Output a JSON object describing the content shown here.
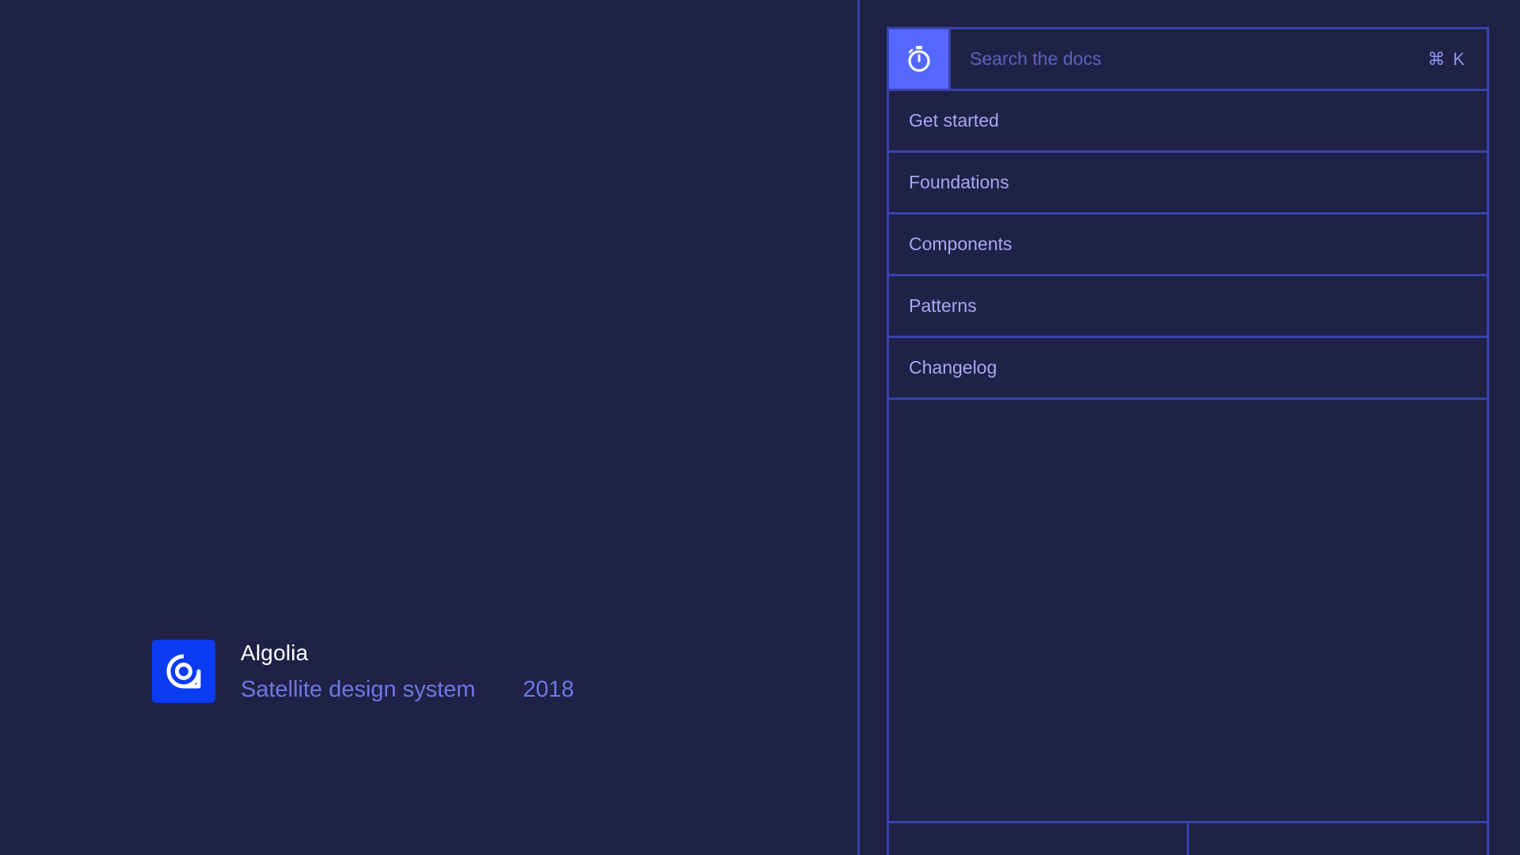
{
  "project": {
    "company": "Algolia",
    "product": "Satellite design system",
    "year": "2018",
    "logo_icon": "algolia-logo-icon",
    "logo_color": "#0a3cf4"
  },
  "docs": {
    "search": {
      "placeholder": "Search the docs",
      "value": "",
      "shortcut": "⌘ K",
      "logo_icon": "stopwatch-icon",
      "logo_color": "#5468ff"
    },
    "nav": [
      {
        "label": "Get started"
      },
      {
        "label": "Foundations"
      },
      {
        "label": "Components"
      },
      {
        "label": "Patterns"
      },
      {
        "label": "Changelog"
      }
    ]
  },
  "colors": {
    "background": "#1f2147",
    "border": "#3a42ad",
    "nav_text": "#a4a9f2",
    "muted_text": "#6f77e3"
  }
}
